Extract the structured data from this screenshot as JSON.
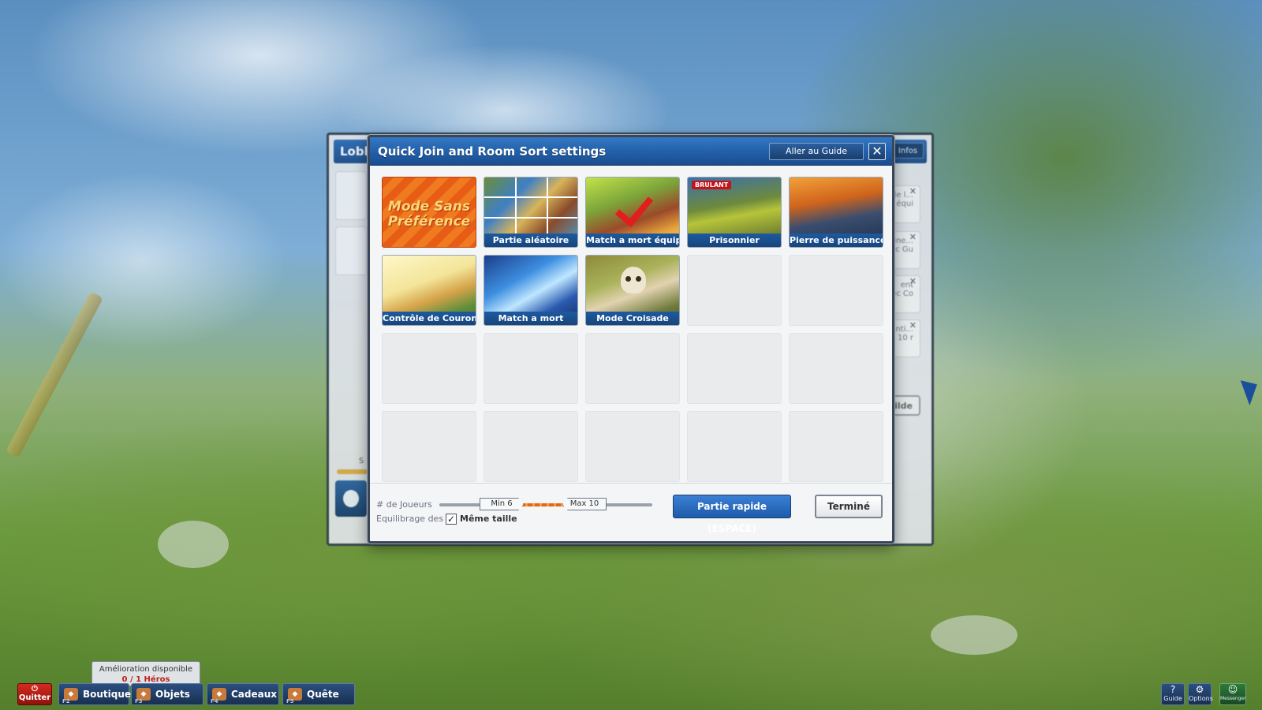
{
  "modal": {
    "title": "Quick Join and Room Sort settings",
    "guide_button": "Aller au Guide",
    "close_glyph": "✕",
    "modes": [
      {
        "label": "Partie aléatoire"
      },
      {
        "label": "Match a mort équipe"
      },
      {
        "label": "Prisonnier",
        "badge": "BRULANT"
      },
      {
        "label": "Pierre de puissance"
      },
      {
        "label": "Contrôle de Couronne"
      },
      {
        "label": "Match a mort"
      },
      {
        "label": "Mode Croisade"
      }
    ],
    "no_preference": {
      "line1": "Mode Sans",
      "line2": "Préférence"
    },
    "players_label": "# de Joueurs",
    "slider": {
      "min_label": "Min 6",
      "max_label": "Max 10",
      "min": 6,
      "max": 10
    },
    "balance_label": "Equilibrage des",
    "same_size_label": "Même taille",
    "same_size_checked": true,
    "quick_button": "Partie rapide (ESPACE)",
    "done_button": "Terminé"
  },
  "lobby": {
    "title": "Lobb",
    "infos": "Infos",
    "cards": [
      {
        "l1": "le l...",
        "l2": "équi"
      },
      {
        "l1": "ine...",
        "l2": "ec Gu"
      },
      {
        "l1": "ent",
        "l2": "ec Co"
      },
      {
        "l1": "nti...",
        "l2": "10 r"
      }
    ],
    "guild_fragment": "ilde",
    "s_label": "S"
  },
  "taskbar": {
    "tooltip_title": "Amélioration disponible",
    "tooltip_value": "0 / 1 Héros",
    "quit": "Quitter",
    "items": [
      {
        "label": "Boutique",
        "key": "F2"
      },
      {
        "label": "Objets",
        "key": "F3"
      },
      {
        "label": "Cadeaux",
        "key": "F4"
      },
      {
        "label": "Quête",
        "key": "F5"
      }
    ],
    "guide": "Guide",
    "options": "Options",
    "messenger": "Messenger"
  }
}
